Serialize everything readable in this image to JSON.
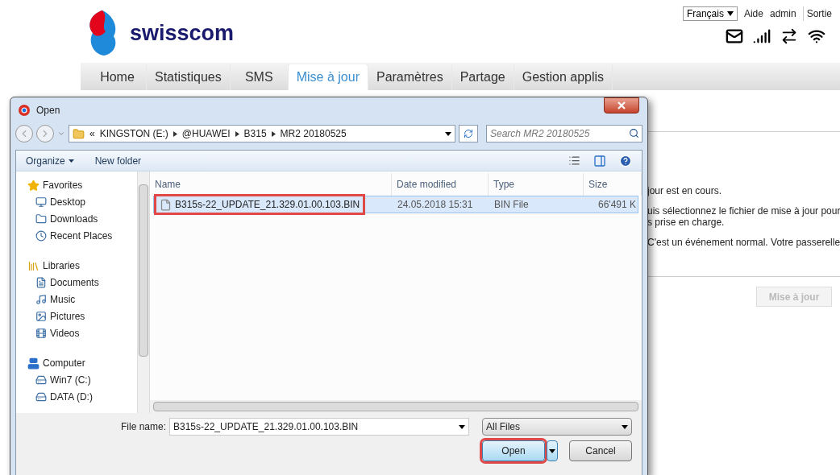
{
  "header": {
    "brand": "swisscom",
    "language": "Français",
    "links": [
      "Aide",
      "admin",
      "Sortie"
    ]
  },
  "nav": {
    "tabs": [
      {
        "label": "Home",
        "selected": false
      },
      {
        "label": "Statistiques",
        "selected": false
      },
      {
        "label": "SMS",
        "selected": false
      },
      {
        "label": "Mise à jour",
        "selected": true
      },
      {
        "label": "Paramètres",
        "selected": false
      },
      {
        "label": "Partage",
        "selected": false
      },
      {
        "label": "Gestion applis",
        "selected": false
      }
    ]
  },
  "page": {
    "lines": [
      "jour est en cours.",
      "uis sélectionnez le fichier de mise à jour pour",
      "s prise en charge.",
      "C'est un événement normal. Votre passerelle"
    ],
    "button": {
      "label": "Mise à jour",
      "disabled": true
    }
  },
  "dialog": {
    "title": "Open",
    "breadcrumb": [
      "«",
      "KINGSTON (E:)",
      "@HUAWEI",
      "B315",
      "MR2 20180525"
    ],
    "search": {
      "placeholder": "Search MR2 20180525"
    },
    "toolbar": [
      "Organize",
      "New folder"
    ],
    "tree": [
      {
        "label": "Favorites",
        "children": [
          {
            "label": "Desktop"
          },
          {
            "label": "Downloads"
          },
          {
            "label": "Recent Places"
          }
        ]
      },
      {
        "label": "Libraries",
        "children": [
          {
            "label": "Documents"
          },
          {
            "label": "Music"
          },
          {
            "label": "Pictures"
          },
          {
            "label": "Videos"
          }
        ]
      },
      {
        "label": "Computer",
        "children": [
          {
            "label": "Win7 (C:)"
          },
          {
            "label": "DATA (D:)"
          }
        ]
      }
    ],
    "columns": [
      "Name",
      "Date modified",
      "Type",
      "Size"
    ],
    "files": [
      {
        "name": "B315s-22_UPDATE_21.329.01.00.103.BIN",
        "date": "24.05.2018 15:31",
        "type": "BIN File",
        "size": "66'491 K",
        "selected": true,
        "highlighted": true
      }
    ],
    "file_name": {
      "label": "File name:",
      "value": "B315s-22_UPDATE_21.329.01.00.103.BIN"
    },
    "filter": "All Files",
    "buttons": [
      {
        "label": "Open",
        "highlighted": true,
        "default": true
      },
      {
        "label": "Cancel",
        "highlighted": false,
        "default": false
      }
    ]
  }
}
